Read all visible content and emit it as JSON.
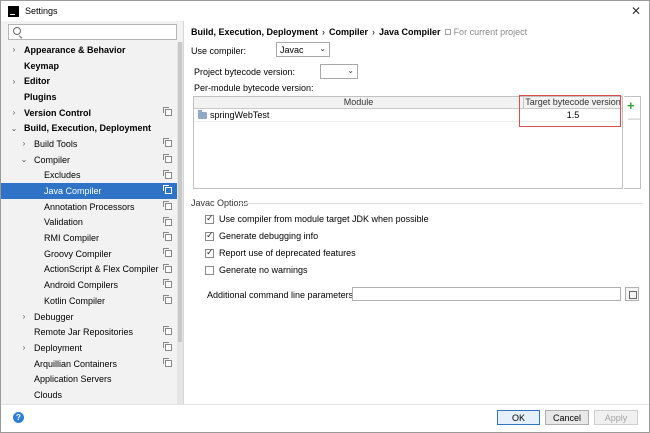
{
  "window": {
    "title": "Settings"
  },
  "search": {
    "placeholder": ""
  },
  "sidebar": {
    "items": [
      {
        "label": "Appearance & Behavior",
        "arrow": "›",
        "bold": true,
        "indent": 0,
        "copy": false
      },
      {
        "label": "Keymap",
        "arrow": "",
        "bold": true,
        "indent": 0,
        "copy": false
      },
      {
        "label": "Editor",
        "arrow": "›",
        "bold": true,
        "indent": 0,
        "copy": false
      },
      {
        "label": "Plugins",
        "arrow": "",
        "bold": true,
        "indent": 0,
        "copy": false
      },
      {
        "label": "Version Control",
        "arrow": "›",
        "bold": true,
        "indent": 0,
        "copy": true
      },
      {
        "label": "Build, Execution, Deployment",
        "arrow": "⌄",
        "bold": true,
        "indent": 0,
        "copy": false
      },
      {
        "label": "Build Tools",
        "arrow": "›",
        "bold": false,
        "indent": 1,
        "copy": true
      },
      {
        "label": "Compiler",
        "arrow": "⌄",
        "bold": false,
        "indent": 1,
        "copy": true
      },
      {
        "label": "Excludes",
        "arrow": "",
        "bold": false,
        "indent": 2,
        "copy": true
      },
      {
        "label": "Java Compiler",
        "arrow": "",
        "bold": false,
        "indent": 2,
        "copy": true,
        "selected": true
      },
      {
        "label": "Annotation Processors",
        "arrow": "",
        "bold": false,
        "indent": 2,
        "copy": true
      },
      {
        "label": "Validation",
        "arrow": "",
        "bold": false,
        "indent": 2,
        "copy": true
      },
      {
        "label": "RMI Compiler",
        "arrow": "",
        "bold": false,
        "indent": 2,
        "copy": true
      },
      {
        "label": "Groovy Compiler",
        "arrow": "",
        "bold": false,
        "indent": 2,
        "copy": true
      },
      {
        "label": "ActionScript & Flex Compiler",
        "arrow": "",
        "bold": false,
        "indent": 2,
        "copy": true
      },
      {
        "label": "Android Compilers",
        "arrow": "",
        "bold": false,
        "indent": 2,
        "copy": true
      },
      {
        "label": "Kotlin Compiler",
        "arrow": "",
        "bold": false,
        "indent": 2,
        "copy": true
      },
      {
        "label": "Debugger",
        "arrow": "›",
        "bold": false,
        "indent": 1,
        "copy": false
      },
      {
        "label": "Remote Jar Repositories",
        "arrow": "",
        "bold": false,
        "indent": 1,
        "copy": true
      },
      {
        "label": "Deployment",
        "arrow": "›",
        "bold": false,
        "indent": 1,
        "copy": true
      },
      {
        "label": "Arquillian Containers",
        "arrow": "",
        "bold": false,
        "indent": 1,
        "copy": true
      },
      {
        "label": "Application Servers",
        "arrow": "",
        "bold": false,
        "indent": 1,
        "copy": false
      },
      {
        "label": "Clouds",
        "arrow": "",
        "bold": false,
        "indent": 1,
        "copy": false
      }
    ]
  },
  "breadcrumb": {
    "parts": [
      "Build, Execution, Deployment",
      "Compiler",
      "Java Compiler"
    ],
    "sep": "›",
    "scope": "For current project"
  },
  "compiler": {
    "label": "Use compiler:",
    "value": "Javac"
  },
  "bytecode": {
    "label": "Project bytecode version:",
    "value": ""
  },
  "per_module": {
    "label": "Per-module bytecode version:",
    "columns": [
      "Module",
      "Target bytecode version"
    ],
    "rows": [
      {
        "module": "springWebTest",
        "target": "1.5"
      }
    ]
  },
  "javac": {
    "title": "Javac Options",
    "options": [
      {
        "label": "Use compiler from module target JDK when possible",
        "checked": true
      },
      {
        "label": "Generate debugging info",
        "checked": true
      },
      {
        "label": "Report use of deprecated features",
        "checked": true
      },
      {
        "label": "Generate no warnings",
        "checked": false
      }
    ],
    "params_label": "Additional command line parameters:",
    "params_value": ""
  },
  "footer": {
    "help": "?",
    "ok": "OK",
    "cancel": "Cancel",
    "apply": "Apply"
  },
  "colors": {
    "selection": "#2e73c6",
    "highlight": "#e04b4b",
    "add": "#34a33a"
  }
}
